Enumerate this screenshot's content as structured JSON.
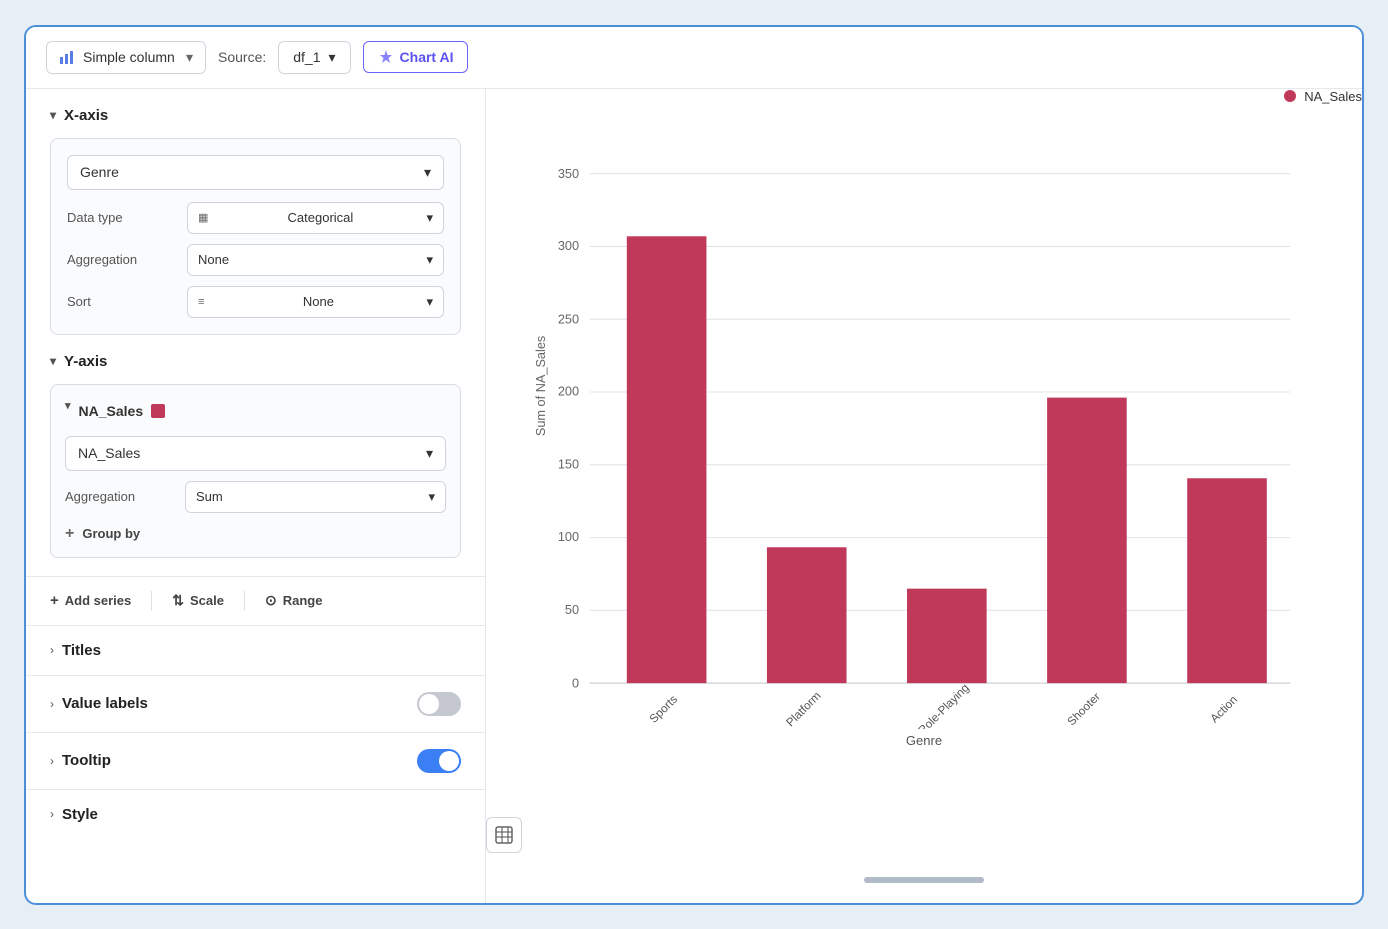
{
  "toolbar": {
    "chart_type_label": "Simple column",
    "source_label": "Source:",
    "source_value": "df_1",
    "chart_ai_label": "Chart AI"
  },
  "x_axis": {
    "section_label": "X-axis",
    "field_value": "Genre",
    "data_type_label": "Data type",
    "data_type_value": "Categorical",
    "aggregation_label": "Aggregation",
    "aggregation_value": "None",
    "sort_label": "Sort",
    "sort_value": "None"
  },
  "y_axis": {
    "section_label": "Y-axis",
    "series_name": "NA_Sales",
    "field_value": "NA_Sales",
    "aggregation_label": "Aggregation",
    "aggregation_value": "Sum",
    "group_by_label": "Group by"
  },
  "actions": {
    "add_series_label": "Add series",
    "scale_label": "Scale",
    "range_label": "Range"
  },
  "sections": {
    "titles_label": "Titles",
    "value_labels_label": "Value labels",
    "value_labels_toggle": "off",
    "tooltip_label": "Tooltip",
    "tooltip_toggle": "on",
    "style_label": "Style"
  },
  "chart": {
    "y_axis_label": "Sum of NA_Sales",
    "x_axis_label": "Genre",
    "legend_label": "NA_Sales",
    "bar_color": "#c0395a",
    "grid_color": "#e0e4ea",
    "y_ticks": [
      0,
      50,
      100,
      150,
      200,
      250,
      300,
      350
    ],
    "bars": [
      {
        "label": "Sports",
        "value": 307
      },
      {
        "label": "Platform",
        "value": 93
      },
      {
        "label": "Role-Playing",
        "value": 65
      },
      {
        "label": "Shooter",
        "value": 196
      },
      {
        "label": "Action",
        "value": 141
      }
    ]
  }
}
